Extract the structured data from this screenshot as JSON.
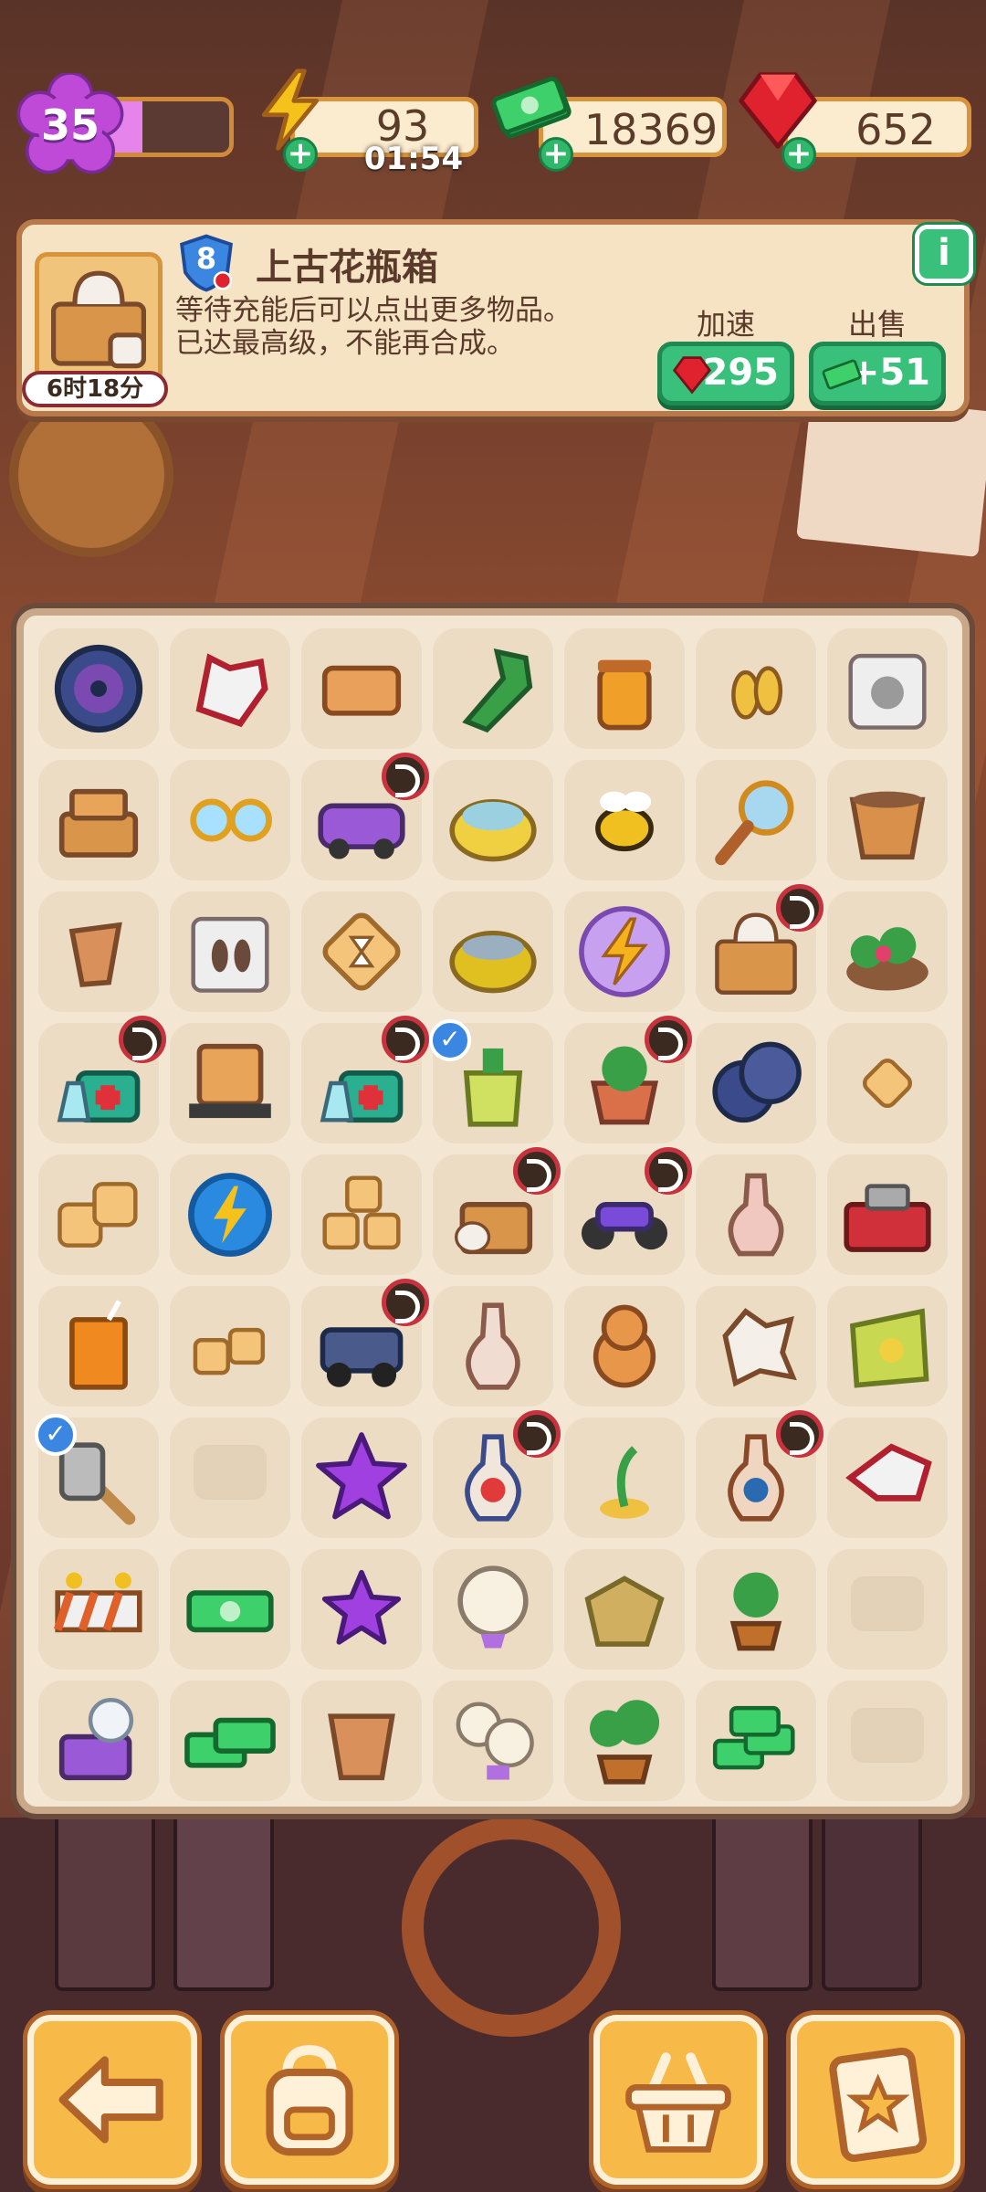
{
  "status": {
    "level": "35",
    "level_progress": 0.3,
    "energy": "93",
    "energy_timer": "01:54",
    "cash": "18369",
    "gems": "652"
  },
  "info_panel": {
    "level": "8",
    "title": "上古花瓶箱",
    "desc_line1": "等待充能后可以点出更多物品。",
    "desc_line2": "已达最高级，不能再合成。",
    "timer": "6时18分",
    "speed_label": "加速",
    "speed_cost": "295",
    "sell_label": "出售",
    "sell_value": "+51",
    "info_icon": "i"
  },
  "board": {
    "rows": [
      [
        "wheel",
        "glove",
        "leather",
        "green-glove",
        "honey-jar",
        "seeds",
        "bag-item"
      ],
      [
        "box-stack",
        "glasses",
        "purple-car",
        "sewing-basket",
        "bee",
        "magnifier",
        "pot"
      ],
      [
        "broken-pot",
        "footprint-bag",
        "hourglass-tile",
        "yellow-basket",
        "energy-orb",
        "vase-box",
        "flower-bed"
      ],
      [
        "medkit",
        "parcel-cart",
        "medkit",
        "lotion",
        "plant-box",
        "wheels",
        "small-tile"
      ],
      [
        "tiles-2",
        "energy-coin",
        "tiles-3",
        "pottery-box",
        "motorbike",
        "vase-pink",
        "toolbox"
      ],
      [
        "juice",
        "tiles-2s",
        "jeep",
        "vase-clear",
        "teddy",
        "leaf-fossil",
        "seed-bag"
      ],
      [
        "hammer",
        "empty",
        "star-purple",
        "vase-blue",
        "sprout",
        "vase-orange",
        "glove-red"
      ],
      [
        "barrier",
        "cash",
        "star-small",
        "lamp",
        "map",
        "sapling",
        "empty"
      ],
      [
        "crystal-box",
        "cash-stack",
        "clay-pot",
        "lamps",
        "bonsai",
        "cash-pile",
        "empty"
      ]
    ],
    "timer_badges": [
      "purple-car",
      "vase-box",
      "medkit",
      "plant-box",
      "pottery-box",
      "motorbike",
      "jeep",
      "vase-blue",
      "vase-orange"
    ],
    "check_badges": [
      "lotion",
      "hammer"
    ]
  },
  "nav": {
    "back": "back-arrow-icon",
    "bag": "backpack-icon",
    "shop": "basket-icon",
    "tasks": "clipboard-star-icon"
  }
}
